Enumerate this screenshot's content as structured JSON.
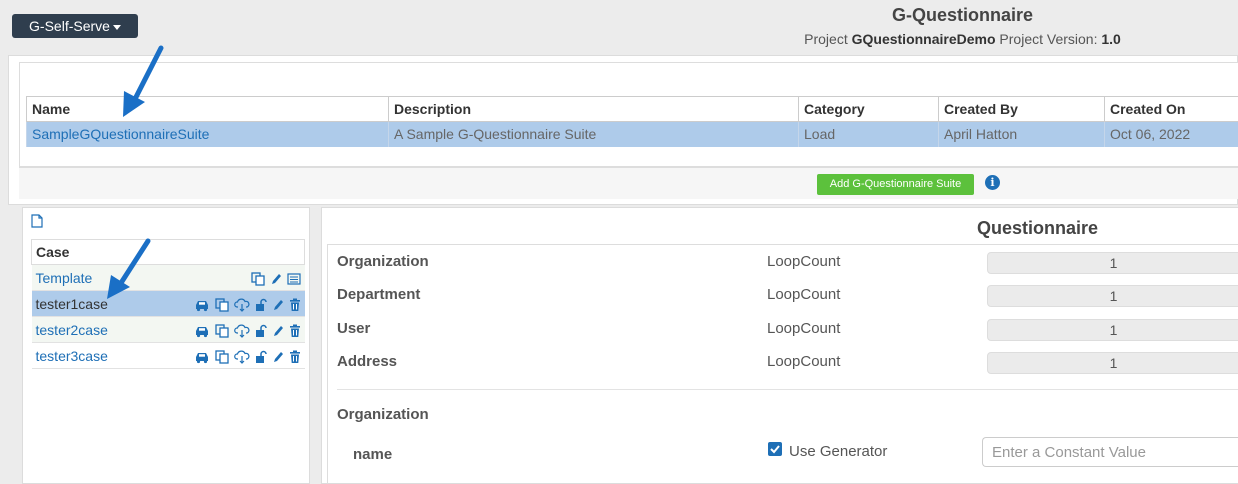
{
  "header": {
    "dropdown_label": "G-Self-Serve",
    "app_title": "G-Questionnaire",
    "project_prefix": "Project",
    "project_name": "GQuestionnaireDemo",
    "version_label": "Project Version:",
    "version_value": "1.0"
  },
  "suites": {
    "columns": [
      "Name",
      "Description",
      "Category",
      "Created By",
      "Created On"
    ],
    "rows": [
      {
        "name": "SampleGQuestionnaireSuite",
        "description": "A Sample G-Questionnaire Suite",
        "category": "Load",
        "created_by": "April Hatton",
        "created_on": "Oct 06, 2022"
      }
    ],
    "add_button_label": "Add G-Questionnaire Suite",
    "info_glyph": "i"
  },
  "cases": {
    "header": "Case",
    "items": [
      {
        "name": "Template"
      },
      {
        "name": "tester1case"
      },
      {
        "name": "tester2case"
      },
      {
        "name": "tester3case"
      }
    ]
  },
  "questionnaire": {
    "title": "Questionnaire",
    "entities": [
      {
        "label": "Organization",
        "type": "LoopCount",
        "value": "1"
      },
      {
        "label": "Department",
        "type": "LoopCount",
        "value": "1"
      },
      {
        "label": "User",
        "type": "LoopCount",
        "value": "1"
      },
      {
        "label": "Address",
        "type": "LoopCount",
        "value": "1"
      }
    ],
    "section_title": "Organization",
    "field_name": "name",
    "use_generator_label": "Use Generator",
    "use_generator_checked": true,
    "constant_placeholder": "Enter a Constant Value"
  },
  "colors": {
    "accent": "#1e6fb6",
    "selected_row": "#aecbea",
    "add_button": "#5cc13c",
    "dropdown_bg": "#2f3e4e"
  }
}
